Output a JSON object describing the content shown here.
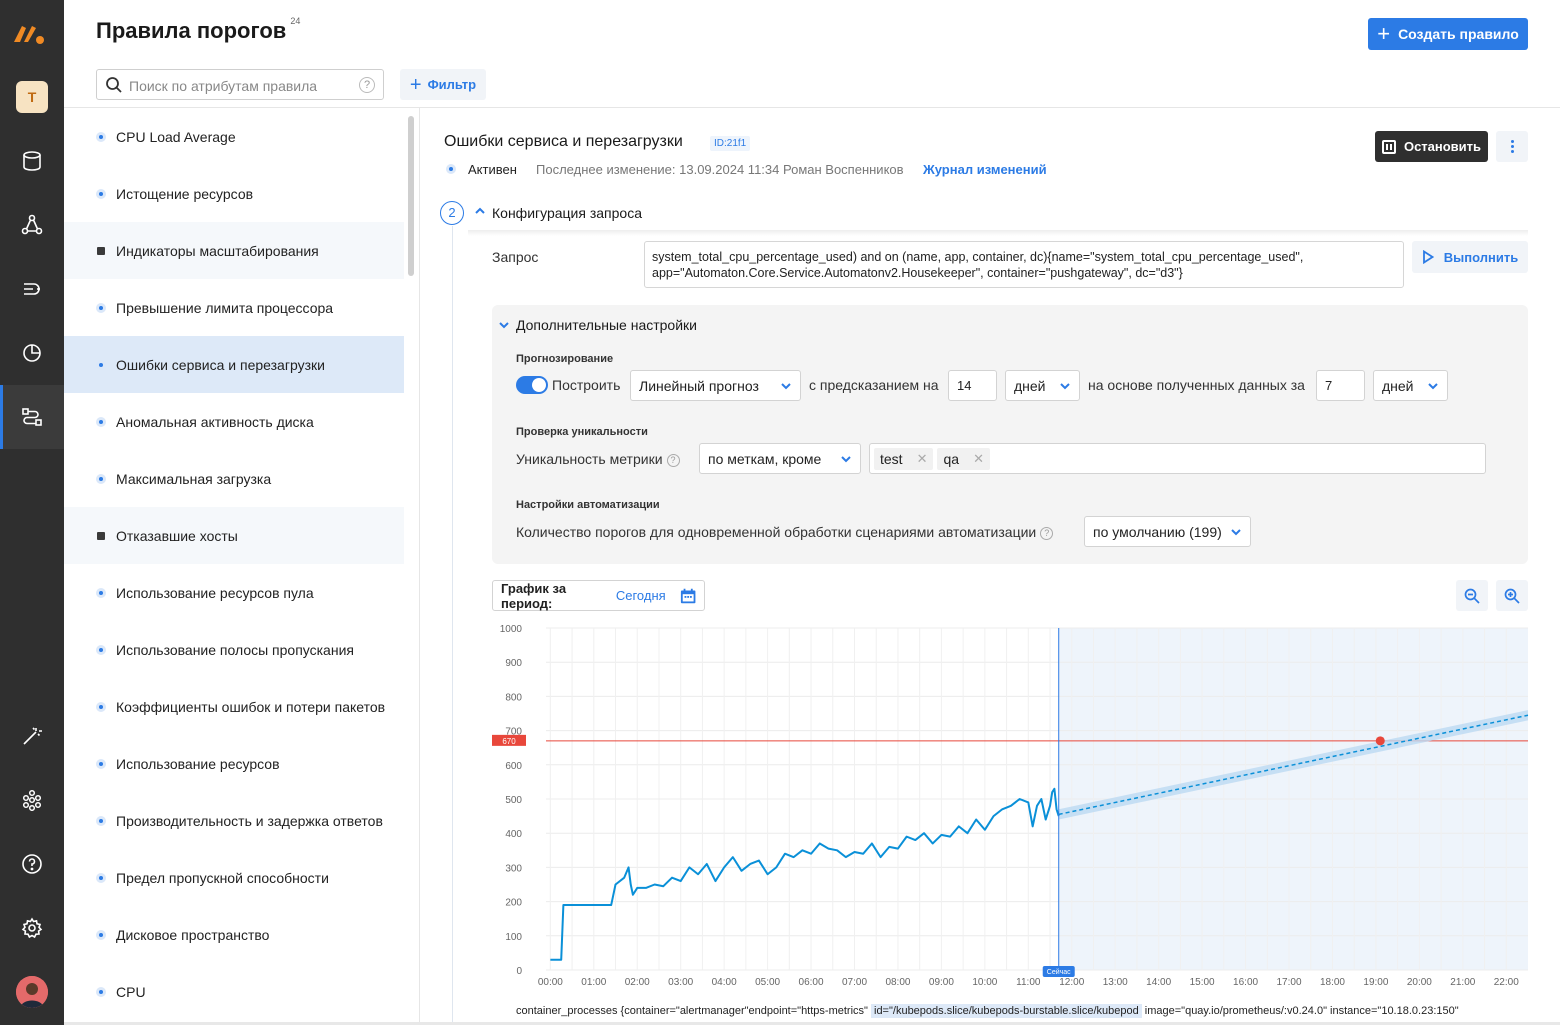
{
  "header": {
    "title": "Правила порогов",
    "count": "24",
    "create_label": "Создать правило",
    "search_placeholder": "Поиск по атрибутам правила",
    "filter_label": "Фильтр"
  },
  "rail": {
    "workspace_letter": "T",
    "nav_icons": [
      "database-icon",
      "network-icon",
      "pipeline-icon",
      "pie-chart-icon",
      "rules-icon",
      "magic-wand-icon",
      "cluster-icon",
      "help-icon",
      "settings-icon"
    ],
    "active_index": 4
  },
  "rules": [
    {
      "label": "CPU Load Average",
      "marker": "dot"
    },
    {
      "label": "Истощение ресурсов",
      "marker": "dot"
    },
    {
      "label": "Индикаторы масштабирования",
      "marker": "square"
    },
    {
      "label": "Превышение лимита процессора",
      "marker": "dot"
    },
    {
      "label": "Ошибки сервиса и перезагрузки",
      "marker": "dot",
      "selected": true
    },
    {
      "label": "Аномальная активность диска",
      "marker": "dot"
    },
    {
      "label": "Максимальная загрузка",
      "marker": "dot"
    },
    {
      "label": "Отказавшие хосты",
      "marker": "square"
    },
    {
      "label": "Использование ресурсов пула",
      "marker": "dot"
    },
    {
      "label": "Использование полосы пропускания",
      "marker": "dot"
    },
    {
      "label": "Коэффициенты ошибок и потери пакетов",
      "marker": "dot"
    },
    {
      "label": "Использование ресурсов",
      "marker": "dot"
    },
    {
      "label": "Производительность и задержка ответов",
      "marker": "dot"
    },
    {
      "label": "Предел пропускной способности",
      "marker": "dot"
    },
    {
      "label": "Дисковое пространство",
      "marker": "dot"
    },
    {
      "label": "CPU",
      "marker": "dot"
    }
  ],
  "detail": {
    "title": "Ошибки сервиса и перезагрузки",
    "id": "ID:21f1",
    "stop_label": "Остановить",
    "status": "Активен",
    "last_modified": "Последнее изменение: 13.09.2024 11:34 Роман Воспенников",
    "journal_link": "Журнал изменений",
    "step_number": "2",
    "section_title": "Конфигурация запроса",
    "query_label": "Запрос",
    "query_line1": "system_total_cpu_percentage_used) and on (name, app, container, dc){name=\"system_total_cpu_percentage_used\",",
    "query_line2": "app=\"Automaton.Core.Service.Automatonv2.Housekeeper\", container=\"pushgateway\", dc=\"d3\"}",
    "run_label": "Выполнить"
  },
  "advanced": {
    "title": "Дополнительные настройки",
    "forecast_heading": "Прогнозирование",
    "build_label": "Построить",
    "build_enabled": true,
    "forecast_type": "Линейный прогноз",
    "predict_label": "с предсказанием на",
    "predict_value": "14",
    "predict_unit": "дней",
    "based_label": "на основе полученных данных за",
    "based_value": "7",
    "based_unit": "дней",
    "uniq_heading": "Проверка уникальности",
    "uniq_label": "Уникальность метрики",
    "uniq_mode": "по меткам, кроме",
    "uniq_tags": [
      "test",
      "qa"
    ],
    "auto_heading": "Настройки автоматизации",
    "auto_label": "Количество порогов для одновременной обработки сценариями автоматизации",
    "auto_value": "по умолчанию (199)"
  },
  "chart_toolbar": {
    "period_label": "График за период:",
    "period_value": "Сегодня"
  },
  "chart_data": {
    "type": "line",
    "ylim": [
      0,
      1000
    ],
    "yticks": [
      0,
      100,
      200,
      300,
      400,
      500,
      600,
      700,
      800,
      900,
      1000
    ],
    "xticks": [
      "00:00",
      "01:00",
      "02:00",
      "03:00",
      "04:00",
      "05:00",
      "06:00",
      "07:00",
      "08:00",
      "09:00",
      "10:00",
      "11:00",
      "12:00",
      "13:00",
      "14:00",
      "15:00",
      "16:00",
      "17:00",
      "18:00",
      "19:00",
      "20:00",
      "21:00",
      "22:00"
    ],
    "threshold": 670,
    "threshold_label": "670",
    "now_label": "Сейчас",
    "now_hour": 11.7,
    "series": [
      {
        "kind": "actual",
        "x": [
          0.0,
          0.15,
          0.25,
          0.3,
          1.0,
          1.4,
          1.5,
          1.7,
          1.8,
          1.85,
          1.9,
          2.0,
          2.2,
          2.4,
          2.6,
          2.8,
          3.0,
          3.2,
          3.4,
          3.6,
          3.8,
          4.0,
          4.2,
          4.4,
          4.6,
          4.8,
          5.0,
          5.2,
          5.4,
          5.6,
          5.8,
          6.0,
          6.2,
          6.4,
          6.6,
          6.8,
          7.0,
          7.2,
          7.4,
          7.6,
          7.8,
          8.0,
          8.2,
          8.4,
          8.6,
          8.8,
          9.0,
          9.2,
          9.4,
          9.6,
          9.8,
          10.0,
          10.2,
          10.4,
          10.6,
          10.8,
          11.0,
          11.1,
          11.2,
          11.3,
          11.4,
          11.5,
          11.55,
          11.6,
          11.65,
          11.7
        ],
        "y": [
          30,
          30,
          30,
          190,
          190,
          190,
          250,
          270,
          300,
          250,
          220,
          240,
          240,
          250,
          245,
          270,
          260,
          300,
          280,
          310,
          260,
          300,
          330,
          290,
          310,
          320,
          280,
          300,
          340,
          330,
          350,
          340,
          370,
          355,
          350,
          330,
          345,
          340,
          370,
          330,
          360,
          355,
          390,
          380,
          400,
          370,
          395,
          390,
          420,
          400,
          440,
          410,
          450,
          470,
          480,
          500,
          490,
          420,
          480,
          500,
          440,
          480,
          520,
          530,
          470,
          450
        ]
      },
      {
        "kind": "forecast",
        "x": [
          11.7,
          22.5
        ],
        "y": [
          455,
          745
        ],
        "band": 15
      }
    ],
    "crossing": {
      "x": 19.1,
      "y": 670
    }
  },
  "chart_legend": {
    "prefix": "container_processes {container=\"alertmanager\"endpoint=\"https-metrics\"",
    "highlight": "id=\"/kubepods.slice/kubepods-burstable.slice/kubepod",
    "suffix": "image=\"quay.io/prometheus/:v0.24.0\"  instance=\"10.18.0.23:150\""
  },
  "colors": {
    "accent": "#2c7be5",
    "rail": "#2f2f2f",
    "threshold": "#e8473b",
    "series": "#0a90d8",
    "forecast_band": "#bcdaf2"
  }
}
